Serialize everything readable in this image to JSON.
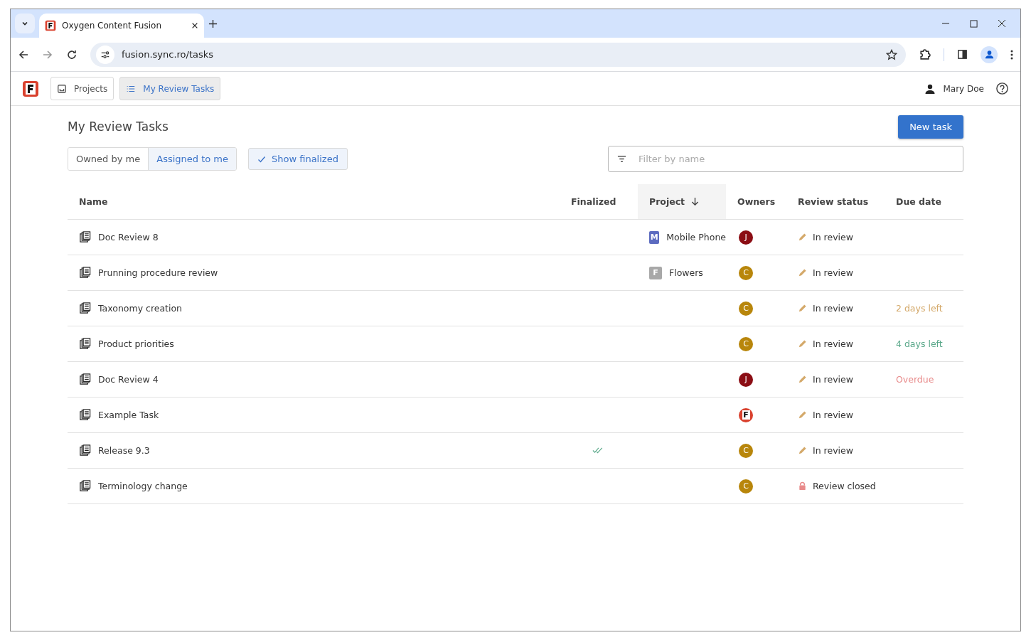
{
  "browser": {
    "tab_title": "Oxygen Content Fusion",
    "url": "fusion.sync.ro/tasks"
  },
  "app_nav": {
    "items": [
      {
        "label": "Projects",
        "kind": "projects",
        "selected": false
      },
      {
        "label": "My Review Tasks",
        "kind": "tasks",
        "selected": true
      }
    ],
    "user": "Mary Doe"
  },
  "page": {
    "title": "My Review Tasks",
    "new_task_button": "New task",
    "segments": [
      {
        "label": "Owned by me",
        "selected": false
      },
      {
        "label": "Assigned to me",
        "selected": true
      }
    ],
    "show_finalized": {
      "label": "Show finalized",
      "checked": true
    },
    "filter": {
      "placeholder": "Filter by name"
    }
  },
  "table": {
    "columns": [
      {
        "label": "Name",
        "sorted": false
      },
      {
        "label": "Finalized",
        "sorted": false
      },
      {
        "label": "Project",
        "sorted": true
      },
      {
        "label": "Owners",
        "sorted": false
      },
      {
        "label": "Review status",
        "sorted": false
      },
      {
        "label": "Due date",
        "sorted": false
      }
    ],
    "rows": [
      {
        "name": "Doc Review 8",
        "finalized": false,
        "project": {
          "badge": "M",
          "name": "Mobile Phone",
          "color": "#5c6bc0"
        },
        "owner": {
          "kind": "letter",
          "initial": "J",
          "color": "#8b0d14"
        },
        "status": {
          "kind": "in_review",
          "label": "In review"
        }
      },
      {
        "name": "Prunning procedure review",
        "finalized": false,
        "project": {
          "badge": "F",
          "name": "Flowers",
          "color": "#a8a8a8"
        },
        "owner": {
          "kind": "letter",
          "initial": "C",
          "color": "#b8860b"
        },
        "status": {
          "kind": "in_review",
          "label": "In review"
        }
      },
      {
        "name": "Taxonomy creation",
        "finalized": false,
        "owner": {
          "kind": "letter",
          "initial": "C",
          "color": "#b8860b"
        },
        "status": {
          "kind": "in_review",
          "label": "In review"
        },
        "due": {
          "text": "2 days left",
          "color": "#d4a96a"
        }
      },
      {
        "name": "Product priorities",
        "finalized": false,
        "owner": {
          "kind": "letter",
          "initial": "C",
          "color": "#b8860b"
        },
        "status": {
          "kind": "in_review",
          "label": "In review"
        },
        "due": {
          "text": "4 days left",
          "color": "#5aa88a"
        }
      },
      {
        "name": "Doc Review 4",
        "finalized": false,
        "owner": {
          "kind": "letter",
          "initial": "J",
          "color": "#8b0d14"
        },
        "status": {
          "kind": "in_review",
          "label": "In review"
        },
        "due": {
          "text": "Overdue",
          "color": "#e88a8a"
        }
      },
      {
        "name": "Example Task",
        "finalized": false,
        "owner": {
          "kind": "logo",
          "initial": "F",
          "color": "#d9412e"
        },
        "status": {
          "kind": "in_review",
          "label": "In review"
        }
      },
      {
        "name": "Release 9.3",
        "finalized": true,
        "owner": {
          "kind": "letter",
          "initial": "C",
          "color": "#b8860b"
        },
        "status": {
          "kind": "in_review",
          "label": "In review"
        }
      },
      {
        "name": "Terminology change",
        "finalized": false,
        "owner": {
          "kind": "letter",
          "initial": "C",
          "color": "#b8860b"
        },
        "status": {
          "kind": "closed",
          "label": "Review closed"
        }
      }
    ]
  }
}
